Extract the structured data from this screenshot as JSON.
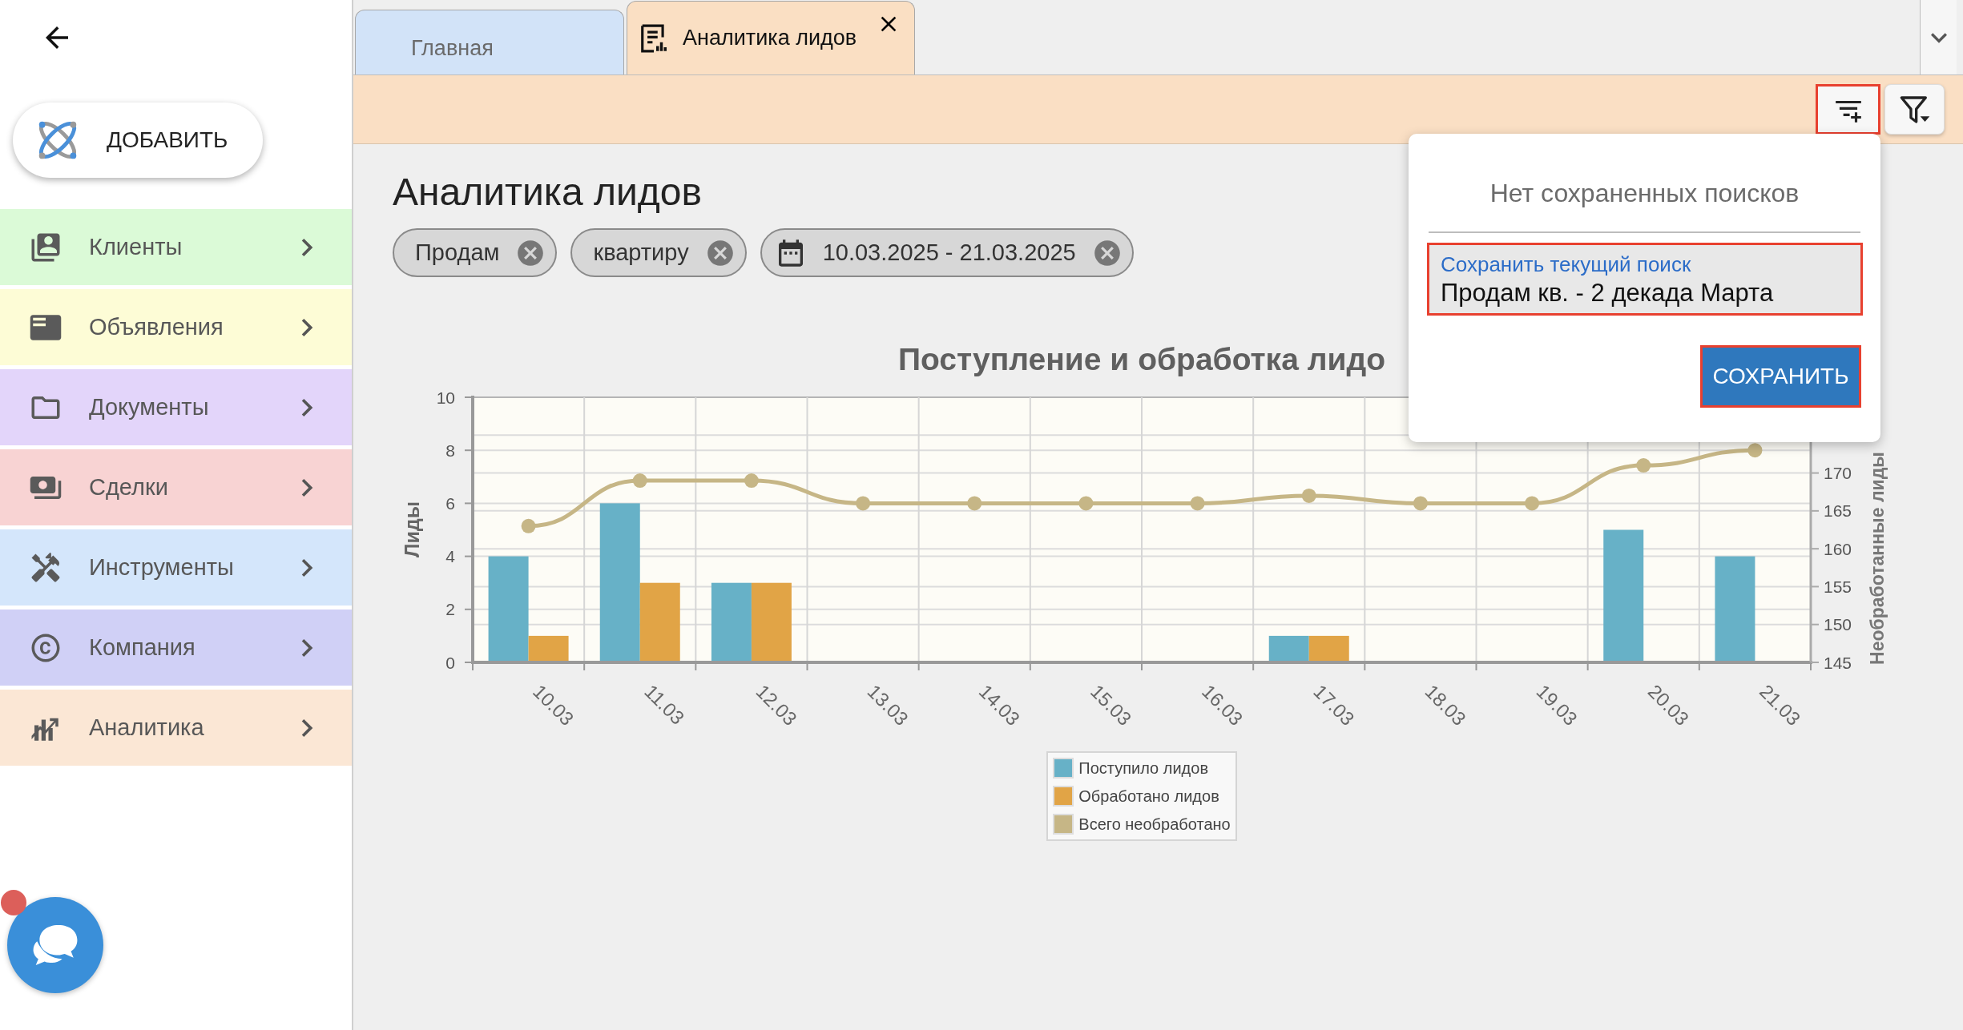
{
  "sidebar": {
    "add_button": {
      "label": "ДОБАВИТЬ"
    },
    "menu": [
      {
        "label": "Клиенты",
        "color": "#dbfad7"
      },
      {
        "label": "Объявления",
        "color": "#fdfcd6"
      },
      {
        "label": "Документы",
        "color": "#e3d5fa"
      },
      {
        "label": "Сделки",
        "color": "#f8d3d3"
      },
      {
        "label": "Инструменты",
        "color": "#d4e6fb"
      },
      {
        "label": "Компания",
        "color": "#d0d0f6"
      },
      {
        "label": "Аналитика",
        "color": "#fbe7d5"
      }
    ]
  },
  "chat": {
    "unread": true
  },
  "tabs": [
    {
      "label": "Главная",
      "selected": false,
      "closable": false
    },
    {
      "label": "Аналитика лидов",
      "selected": true,
      "closable": true
    }
  ],
  "toolbar": {
    "buttons": [
      {
        "kind": "save_search",
        "highlighted": true
      },
      {
        "kind": "filter",
        "highlighted": false
      }
    ]
  },
  "page": {
    "title": "Аналитика лидов",
    "chips": [
      {
        "kind": "text",
        "label": "Продам"
      },
      {
        "kind": "text",
        "label": "квартиру"
      },
      {
        "kind": "date",
        "label": "10.03.2025 - 21.03.2025"
      }
    ]
  },
  "chart": {
    "chart_data": {
      "type": "bar",
      "title": "Поступление и обработка лидо",
      "ylabel": "Лиды",
      "y2label": "Необработанные лиды",
      "categories": [
        "10.03",
        "11.03",
        "12.03",
        "13.03",
        "14.03",
        "15.03",
        "16.03",
        "17.03",
        "18.03",
        "19.03",
        "20.03",
        "21.03"
      ],
      "series": [
        {
          "name": "Поступило лидов",
          "color": "#67b1c7",
          "values": [
            4,
            6,
            3,
            0,
            0,
            0,
            0,
            1,
            0,
            0,
            5,
            4
          ]
        },
        {
          "name": "Обработано лидов",
          "color": "#e1a446",
          "values": [
            1,
            3,
            3,
            0,
            0,
            0,
            0,
            1,
            0,
            0,
            0,
            0
          ]
        },
        {
          "name": "Всего необработано",
          "type": "line",
          "axis": "y2",
          "marker": "circle",
          "color": "#c6b686",
          "values": [
            163,
            169,
            169,
            166,
            166,
            166,
            166,
            167,
            166,
            166,
            171,
            173
          ]
        }
      ],
      "ylim": [
        0,
        10
      ],
      "yticks": [
        0,
        2,
        4,
        6,
        8,
        10
      ],
      "y2lim": [
        145,
        180
      ],
      "y2ticks": [
        145,
        150,
        155,
        160,
        165,
        170
      ],
      "grid": true
    }
  },
  "popover": {
    "empty_text": "Нет сохраненных поисков",
    "field": {
      "label": "Сохранить текущий поиск",
      "value": "Продам кв. - 2 декада Марта",
      "highlighted": true
    },
    "save_button": {
      "label": "СОХРАНИТЬ",
      "highlighted": true
    }
  }
}
